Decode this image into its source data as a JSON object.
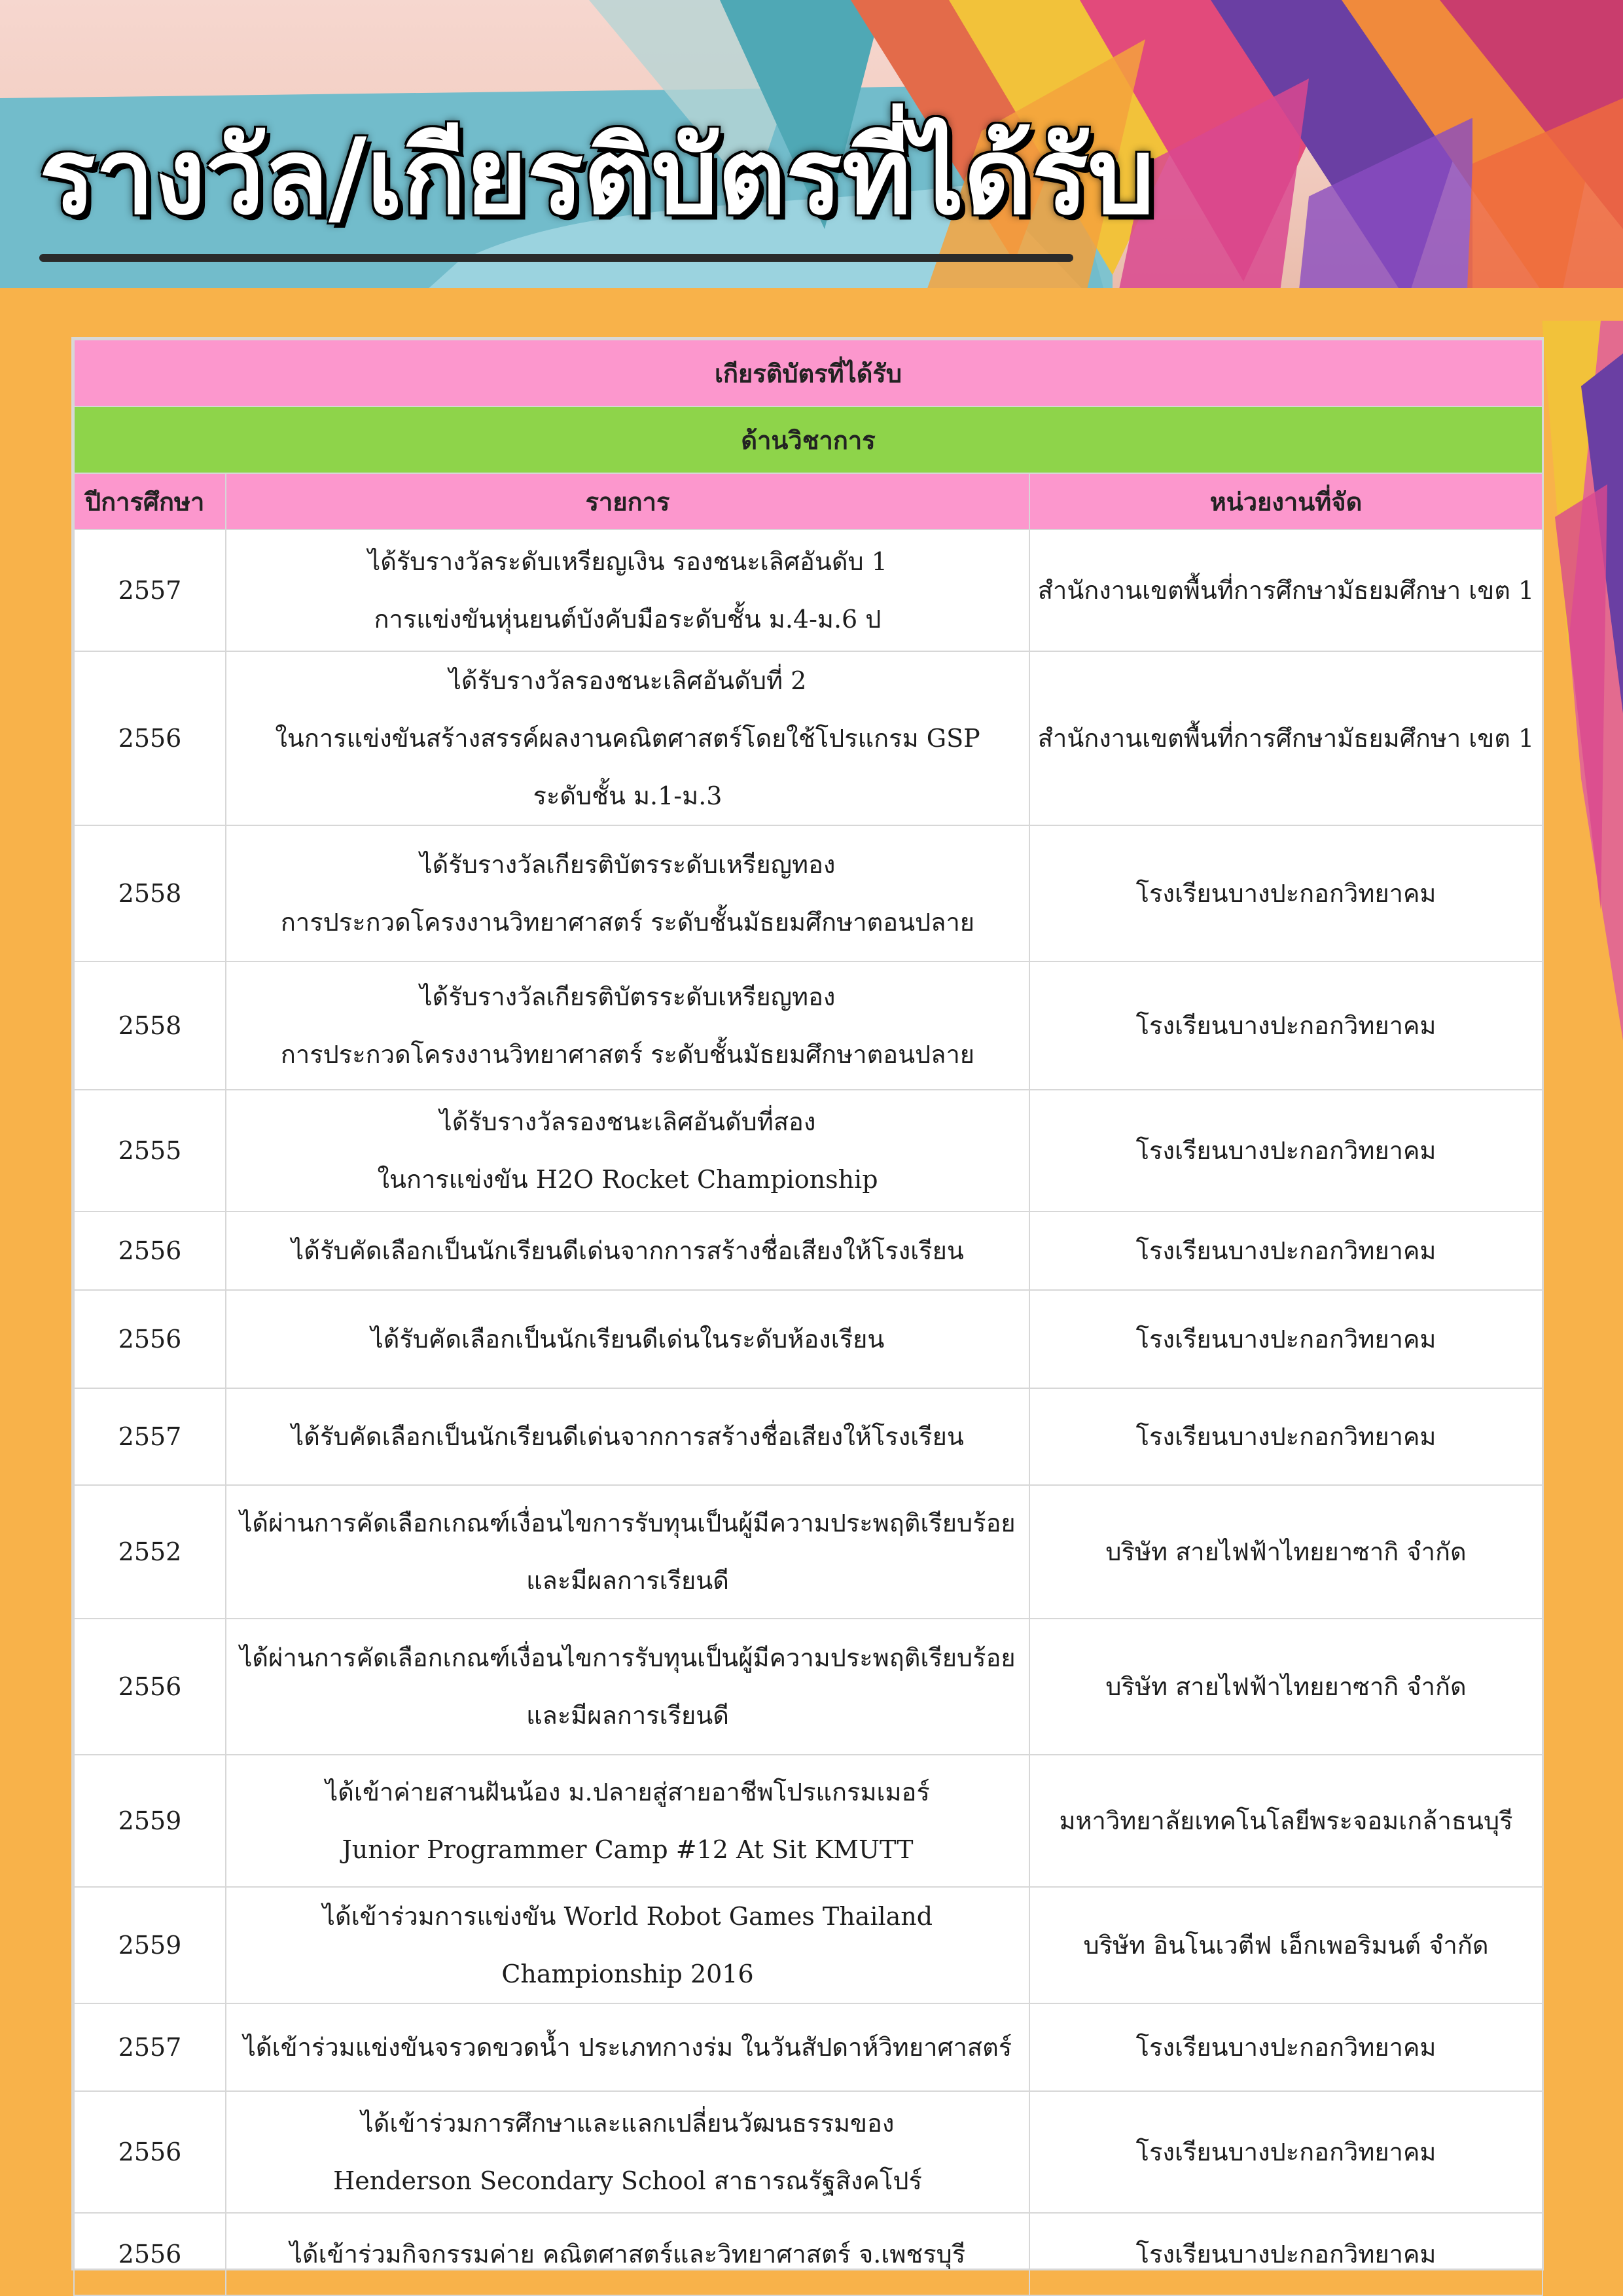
{
  "page_title": "รางวัล/เกียรติบัตรที่ได้รับ",
  "table_title": "เกียรติบัตรที่ได้รับ",
  "section_title": "ด้านวิชาการ",
  "columns": {
    "year": "ปีการศึกษา",
    "item": "รายการ",
    "organizer": "หน่วยงานที่จัด"
  },
  "rows": [
    {
      "year": "2557",
      "lines": [
        "ได้รับรางวัลระดับเหรียญเงิน รองชนะเลิศอันดับ 1",
        "การแข่งขันหุ่นยนต์บังคับมือระดับชั้น ม.4-ม.6 ป"
      ],
      "org": "สำนักงานเขตพื้นที่การศึกษามัธยมศึกษา เขต 1"
    },
    {
      "year": "2556",
      "lines": [
        "ได้รับรางวัลรองชนะเลิศอันดับที่ 2",
        "ในการแข่งขันสร้างสรรค์ผลงานคณิตศาสตร์โดยใช้โปรแกรม GSP",
        "ระดับชั้น ม.1-ม.3"
      ],
      "org": "สำนักงานเขตพื้นที่การศึกษามัธยมศึกษา เขต 1"
    },
    {
      "year": "2558",
      "lines": [
        "ได้รับรางวัลเกียรติบัตรระดับเหรียญทอง",
        "การประกวดโครงงานวิทยาศาสตร์ ระดับชั้นมัธยมศึกษาตอนปลาย"
      ],
      "org": "โรงเรียนบางปะกอกวิทยาคม"
    },
    {
      "year": "2558",
      "lines": [
        "ได้รับรางวัลเกียรติบัตรระดับเหรียญทอง",
        "การประกวดโครงงานวิทยาศาสตร์ ระดับชั้นมัธยมศึกษาตอนปลาย"
      ],
      "org": "โรงเรียนบางปะกอกวิทยาคม"
    },
    {
      "year": "2555",
      "lines": [
        "ได้รับรางวัลรองชนะเลิศอันดับที่สอง",
        "ในการแข่งขัน H2O Rocket Championship"
      ],
      "org": "โรงเรียนบางปะกอกวิทยาคม"
    },
    {
      "year": "2556",
      "lines": [
        "ได้รับคัดเลือกเป็นนักเรียนดีเด่นจากการสร้างชื่อเสียงให้โรงเรียน"
      ],
      "org": "โรงเรียนบางปะกอกวิทยาคม"
    },
    {
      "year": "2556",
      "lines": [
        "ได้รับคัดเลือกเป็นนักเรียนดีเด่นในระดับห้องเรียน"
      ],
      "org": "โรงเรียนบางปะกอกวิทยาคม"
    },
    {
      "year": "2557",
      "lines": [
        "ได้รับคัดเลือกเป็นนักเรียนดีเด่นจากการสร้างชื่อเสียงให้โรงเรียน"
      ],
      "org": "โรงเรียนบางปะกอกวิทยาคม"
    },
    {
      "year": "2552",
      "lines": [
        "ได้ผ่านการคัดเลือกเกณฑ์เงื่อนไขการรับทุนเป็นผู้มีความประพฤติเรียบร้อย",
        "และมีผลการเรียนดี"
      ],
      "org": "บริษัท สายไฟฟ้าไทยยาซากิ จำกัด"
    },
    {
      "year": "2556",
      "lines": [
        "ได้ผ่านการคัดเลือกเกณฑ์เงื่อนไขการรับทุนเป็นผู้มีความประพฤติเรียบร้อย",
        "และมีผลการเรียนดี"
      ],
      "org": "บริษัท สายไฟฟ้าไทยยาซากิ จำกัด"
    },
    {
      "year": "2559",
      "lines": [
        "ได้เข้าค่ายสานฝันน้อง ม.ปลายสู่สายอาชีพโปรแกรมเมอร์",
        "Junior Programmer Camp #12 At Sit KMUTT"
      ],
      "org": "มหาวิทยาลัยเทคโนโลยีพระจอมเกล้าธนบุรี"
    },
    {
      "year": "2559",
      "lines": [
        "ได้เข้าร่วมการแข่งขัน World Robot Games Thailand Championship 2016"
      ],
      "org": "บริษัท อินโนเวตีฟ เอ็กเพอริมนต์ จำกัด"
    },
    {
      "year": "2557",
      "lines": [
        "ได้เข้าร่วมแข่งขันจรวดขวดน้ำ ประเภทกางร่ม ในวันสัปดาห์วิทยาศาสตร์"
      ],
      "org": "โรงเรียนบางปะกอกวิทยาคม"
    },
    {
      "year": "2556",
      "lines": [
        "ได้เข้าร่วมการศึกษาและแลกเปลี่ยนวัฒนธรรมของ",
        "Henderson Secondary School สาธารณรัฐสิงคโปร์"
      ],
      "org": "โรงเรียนบางปะกอกวิทยาคม"
    },
    {
      "year": "2556",
      "lines": [
        "ได้เข้าร่วมกิจกรรมค่าย คณิตศาสตร์และวิทยาศาสตร์ จ.เพชรบุรี"
      ],
      "org": "โรงเรียนบางปะกอกวิทยาคม"
    }
  ]
}
